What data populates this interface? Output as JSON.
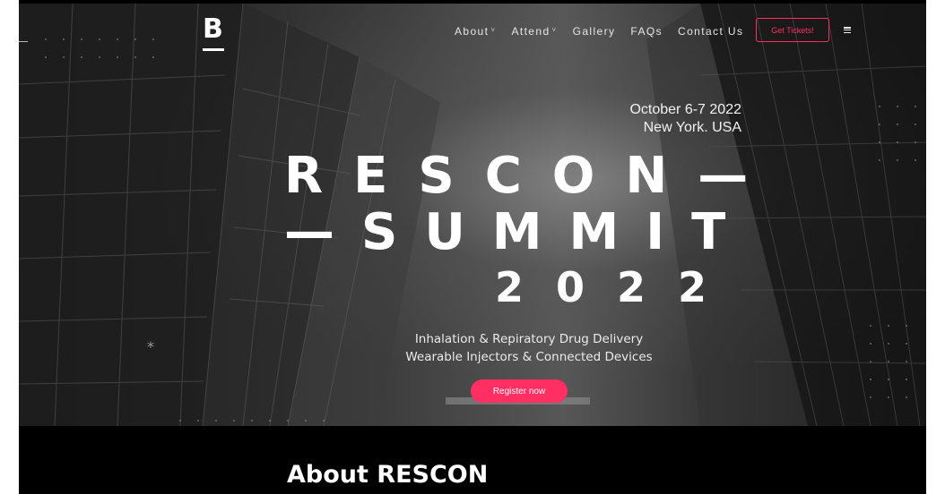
{
  "brand": {
    "logo_letter": "B"
  },
  "nav": {
    "items": [
      {
        "label": "About",
        "has_dropdown": true
      },
      {
        "label": "Attend",
        "has_dropdown": true
      },
      {
        "label": "Gallery",
        "has_dropdown": false
      },
      {
        "label": "FAQs",
        "has_dropdown": false
      },
      {
        "label": "Contact Us",
        "has_dropdown": false
      }
    ],
    "dropdown_glyph": "˅",
    "cta_label": "Get Tickets!",
    "menu_icon": "hamburger-icon"
  },
  "hero": {
    "date": "October 6-7 2022",
    "location": "New York. USA",
    "title_line1": "RESCON—",
    "title_line2": "—SUMMIT",
    "title_line3": "2022",
    "tagline_line1": "Inhalation & Repiratory Drug Delivery",
    "tagline_line2": "Wearable Injectors & Connected Devices",
    "register_label": "Register now",
    "decor_glyph": "*"
  },
  "about": {
    "heading": "About RESCON"
  },
  "colors": {
    "accent": "#ff2e63",
    "background": "#000000",
    "text": "#ffffff"
  }
}
